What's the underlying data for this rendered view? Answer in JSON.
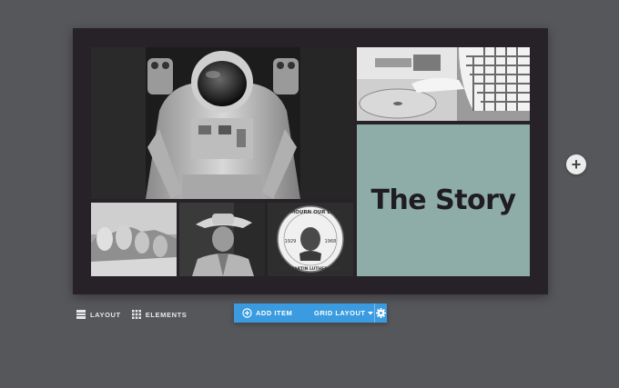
{
  "canvas": {
    "story_title": "The Story",
    "story_bg": "#8fada8",
    "photos": [
      "astronaut-photo",
      "record-player-photo",
      "mount-rushmore-photo",
      "cowboy-photo",
      "mlk-memorial-button-photo"
    ],
    "button_text_top": "WE MOURN OUR LOSS",
    "button_year_left": "1929",
    "button_year_right": "1968",
    "button_text_bottom": "DR. MARTIN LUTHER KING"
  },
  "side": {
    "add_icon": "plus-icon"
  },
  "bottom_left": {
    "layout_label": "LAYOUT",
    "layout_icon": "layout-rows-icon",
    "elements_label": "ELEMENTS",
    "elements_icon": "grid-dots-icon"
  },
  "toolbar": {
    "add_item_label": "ADD ITEM",
    "add_item_icon": "plus-circle-icon",
    "grid_layout_label": "GRID LAYOUT",
    "settings_icon": "gear-icon",
    "accent": "#3a9be0"
  }
}
